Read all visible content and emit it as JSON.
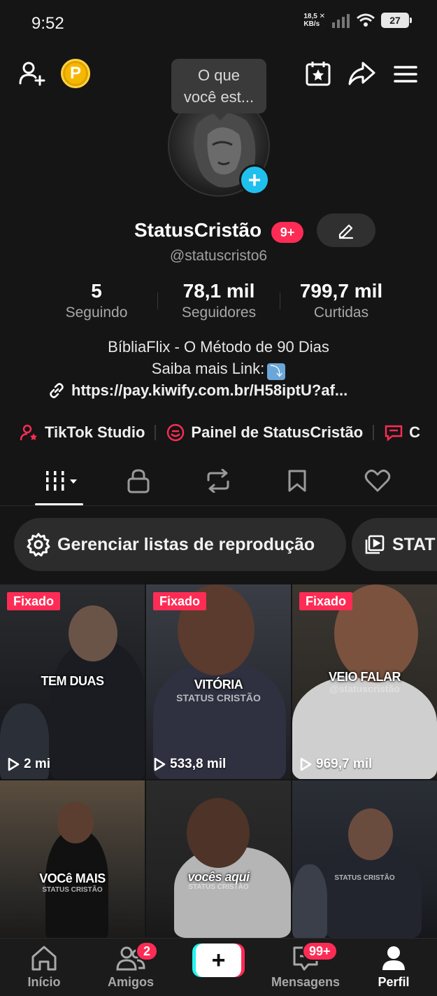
{
  "status_bar": {
    "time": "9:52",
    "net_speed_value": "18,5",
    "net_speed_unit": "KB/s",
    "battery": "27"
  },
  "tooltip": {
    "text_line1": "O que",
    "text_line2": "você est..."
  },
  "profile": {
    "username": "StatusCristão",
    "notif_badge": "9+",
    "handle": "@statuscristo6"
  },
  "stats": [
    {
      "value": "5",
      "label": "Seguindo"
    },
    {
      "value": "78,1 mil",
      "label": "Seguidores"
    },
    {
      "value": "799,7 mil",
      "label": "Curtidas"
    }
  ],
  "bio": {
    "line1": "BíbliaFlix - O Método de 90 Dias",
    "line2": "Saiba mais Link:",
    "arrow_emoji": "⤵",
    "link": "https://pay.kiwify.com.br/H58iptU?af..."
  },
  "shortcuts": [
    {
      "label": "TikTok Studio",
      "icon": "person-star-icon"
    },
    {
      "label": "Painel de StatusCristão",
      "icon": "dashboard-icon"
    },
    {
      "label": "C",
      "icon": "chat-icon"
    }
  ],
  "tabs": [
    {
      "name": "videos",
      "icon": "grid-bars-icon",
      "active": true
    },
    {
      "name": "private",
      "icon": "lock-icon"
    },
    {
      "name": "reposts",
      "icon": "repost-icon"
    },
    {
      "name": "favorites",
      "icon": "bookmark-icon"
    },
    {
      "name": "liked",
      "icon": "heart-icon"
    }
  ],
  "chips": [
    {
      "label": "Gerenciar listas de reprodução",
      "icon": "gear-icon"
    },
    {
      "label": "STAT",
      "icon": "playlist-icon"
    }
  ],
  "videos": [
    {
      "pinned": "Fixado",
      "views": "2 mi",
      "overlay": "TEM DUAS",
      "sub": ""
    },
    {
      "pinned": "Fixado",
      "views": "533,8 mil",
      "overlay": "VITÓRIA",
      "sub": "STATUS CRISTÃO"
    },
    {
      "pinned": "Fixado",
      "views": "969,7 mil",
      "overlay": "VEIO FALAR",
      "sub": "@statuscristão"
    },
    {
      "pinned": "",
      "views": "",
      "overlay": "VOCê MAIS",
      "sub": "STATUS CRISTÃO"
    },
    {
      "pinned": "",
      "views": "",
      "overlay": "vocês aqui",
      "sub": "STATUS CRISTÃO"
    },
    {
      "pinned": "",
      "views": "",
      "overlay": "",
      "sub": "STATUS CRISTÃO"
    }
  ],
  "bottom_nav": [
    {
      "label": "Início",
      "icon": "home-icon"
    },
    {
      "label": "Amigos",
      "icon": "friends-icon",
      "badge": "2"
    },
    {
      "label": "",
      "icon": "plus-icon"
    },
    {
      "label": "Mensagens",
      "icon": "inbox-icon",
      "badge": "99+"
    },
    {
      "label": "Perfil",
      "icon": "profile-icon",
      "active": true
    }
  ],
  "colors": {
    "accent": "#fe2c55",
    "cyan": "#25f4ee",
    "background": "#151515",
    "plus_badge": "#20c0ee"
  }
}
